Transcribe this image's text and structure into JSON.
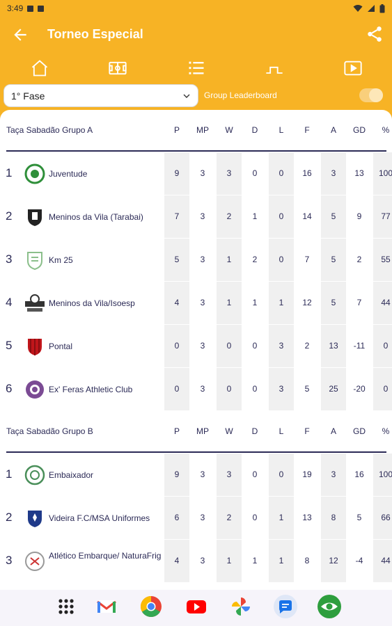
{
  "status_bar": {
    "time": "3:49"
  },
  "app_bar": {
    "title": "Torneo Especial"
  },
  "tabs": [
    {
      "icon": "home-icon"
    },
    {
      "icon": "field-icon"
    },
    {
      "icon": "list-icon",
      "active": true
    },
    {
      "icon": "bracket-icon"
    },
    {
      "icon": "video-icon"
    }
  ],
  "filters": {
    "phase_selected": "1° Fase",
    "group_leaderboard_label": "Group Leaderboard",
    "group_leaderboard_on": true
  },
  "columns": [
    "P",
    "MP",
    "W",
    "D",
    "L",
    "F",
    "A",
    "GD",
    "%"
  ],
  "groups": [
    {
      "title": "Taça Sabadão Grupo A",
      "rows": [
        {
          "pos": "1",
          "team": "Juventude",
          "logo": "green-crest",
          "stats": [
            "9",
            "3",
            "3",
            "0",
            "0",
            "16",
            "3",
            "13",
            "100"
          ]
        },
        {
          "pos": "2",
          "team": "Meninos da Vila (Tarabai)",
          "logo": "dark-shield",
          "stats": [
            "7",
            "3",
            "2",
            "1",
            "0",
            "14",
            "5",
            "9",
            "77"
          ]
        },
        {
          "pos": "3",
          "team": "Km 25",
          "logo": "light-green-shield",
          "stats": [
            "5",
            "3",
            "1",
            "2",
            "0",
            "7",
            "5",
            "2",
            "55"
          ]
        },
        {
          "pos": "4",
          "team": "Meninos da Vila/Isoesp",
          "logo": "banner-crest",
          "stats": [
            "4",
            "3",
            "1",
            "1",
            "1",
            "12",
            "5",
            "7",
            "44"
          ]
        },
        {
          "pos": "5",
          "team": "Pontal",
          "logo": "red-shield",
          "stats": [
            "0",
            "3",
            "0",
            "0",
            "3",
            "2",
            "13",
            "-11",
            "0"
          ]
        },
        {
          "pos": "6",
          "team": "Ex' Feras Athletic Club",
          "logo": "purple-badge",
          "stats": [
            "0",
            "3",
            "0",
            "0",
            "3",
            "5",
            "25",
            "-20",
            "0"
          ]
        }
      ]
    },
    {
      "title": "Taça Sabadão Grupo B",
      "rows": [
        {
          "pos": "1",
          "team": "Embaixador",
          "logo": "green-round",
          "stats": [
            "9",
            "3",
            "3",
            "0",
            "0",
            "19",
            "3",
            "16",
            "100"
          ]
        },
        {
          "pos": "2",
          "team": "Videira F.C/MSA Uniformes",
          "logo": "blue-shield",
          "stats": [
            "6",
            "3",
            "2",
            "0",
            "1",
            "13",
            "8",
            "5",
            "66"
          ]
        },
        {
          "pos": "3",
          "team": "Atlético Embarque/ NaturaFrig",
          "logo": "grey-crest",
          "stats": [
            "4",
            "3",
            "1",
            "1",
            "1",
            "8",
            "12",
            "-4",
            "44"
          ]
        }
      ]
    }
  ],
  "nav_bar": {
    "apps": [
      "apps-grid-icon",
      "gmail-icon",
      "chrome-icon",
      "youtube-icon",
      "photos-icon",
      "messages-icon",
      "eye-app-icon"
    ]
  }
}
